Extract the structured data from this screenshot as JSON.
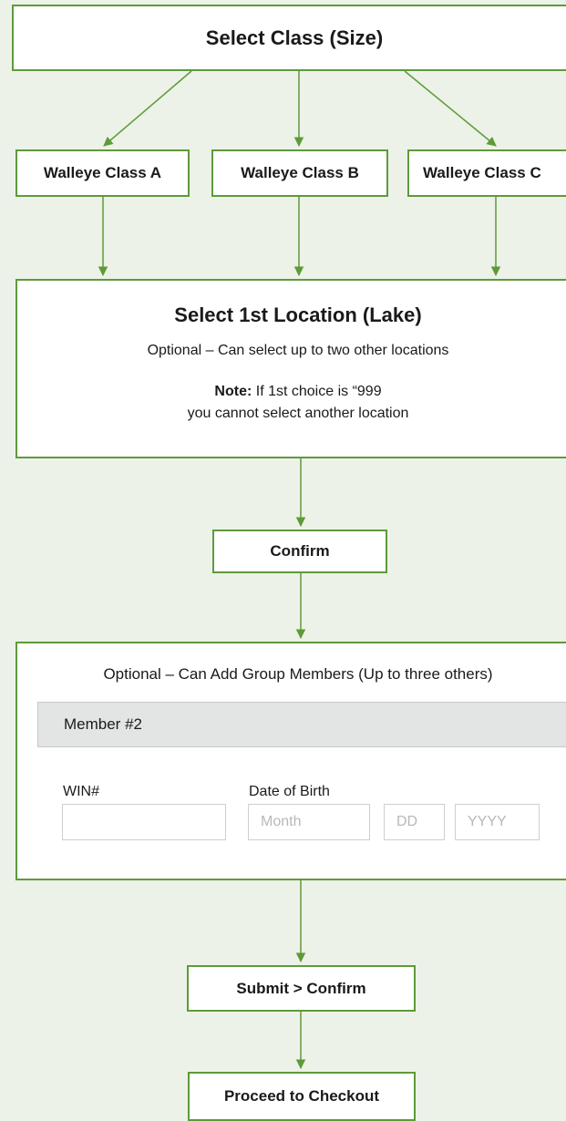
{
  "colors": {
    "background": "#ecf2e7",
    "border": "#5e9a3a",
    "arrow": "#5e9a3a",
    "member_bar": "#e3e4e4"
  },
  "select_class": {
    "title": "Select Class (Size)"
  },
  "classes": [
    "Walleye Class A",
    "Walleye Class B",
    "Walleye Class C"
  ],
  "location": {
    "title": "Select 1st Location (Lake)",
    "subtitle": "Optional – Can select up to two other locations",
    "note_label": "Note:",
    "note_text": " If 1st choice is “999",
    "note_line2": "you cannot select another location"
  },
  "confirm": {
    "label": "Confirm"
  },
  "group": {
    "title": "Optional – Can Add Group Members (Up to three others)",
    "member_label": "Member #2",
    "win_label": "WIN#",
    "win_value": "",
    "dob_label": "Date of Birth",
    "month_placeholder": "Month",
    "day_placeholder": "DD",
    "year_placeholder": "YYYY"
  },
  "submit": {
    "label": "Submit > Confirm"
  },
  "checkout": {
    "label": "Proceed to Checkout"
  }
}
